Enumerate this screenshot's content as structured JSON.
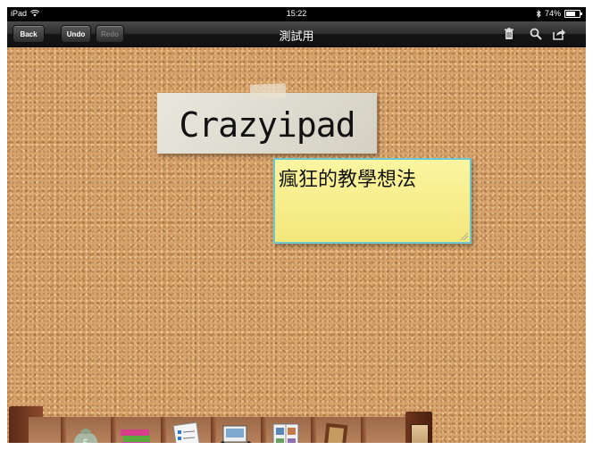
{
  "status_bar": {
    "device": "iPad",
    "time": "15:22",
    "battery_percent": "74%",
    "battery_level": 0.74
  },
  "nav": {
    "back_label": "Back",
    "undo_label": "Undo",
    "redo_label": "Redo",
    "title": "測試用"
  },
  "board": {
    "title_note_text": "Crazyipad",
    "sticky_note_text": "瘋狂的教學想法"
  },
  "shelf": {
    "icons": [
      "money-bag-icon",
      "books-icon",
      "to-do-list-icon",
      "scanner-icon",
      "photo-album-icon",
      "frame-icon"
    ]
  },
  "colors": {
    "corkboard": "#d7a26a",
    "sticky_note": "#f6ec8a",
    "sticky_border": "#6ec7cf",
    "navbar": "#2c2c2c"
  }
}
